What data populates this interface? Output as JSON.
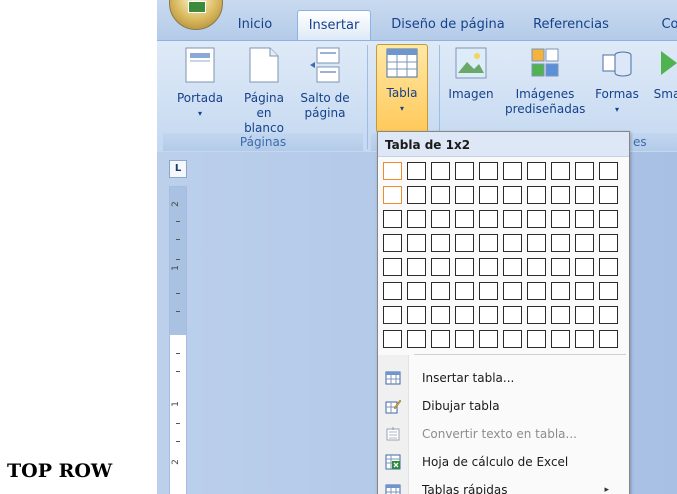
{
  "tabs": [
    {
      "label": "Inicio"
    },
    {
      "label": "Insertar"
    },
    {
      "label": "Diseño de página"
    },
    {
      "label": "Referencias"
    },
    {
      "label": "Co"
    }
  ],
  "ribbon": {
    "portada": {
      "line1": "Portada",
      "drop": "▾"
    },
    "pagina_blanco": {
      "line1": "Página",
      "line2": "en blanco"
    },
    "salto": {
      "line1": "Salto de",
      "line2": "página"
    },
    "tabla": {
      "line1": "Tabla",
      "drop": "▾"
    },
    "imagen": {
      "line1": "Imagen"
    },
    "imagenes_pred": {
      "line1": "Imágenes",
      "line2": "prediseñadas"
    },
    "formas": {
      "line1": "Formas",
      "drop": "▾"
    },
    "smart": {
      "line1": "Sma"
    },
    "group_paginas": "Páginas",
    "group_partial": "es"
  },
  "ruler": {
    "label": "L",
    "numbers": [
      "2",
      "1",
      "1",
      "2"
    ]
  },
  "dropdown": {
    "title": "Tabla de 1x2",
    "grid_cols": 10,
    "grid_rows": 8,
    "selected_cols": 1,
    "selected_rows": 2,
    "items": [
      {
        "label": "Insertar tabla...",
        "icon": "insert-table-icon",
        "disabled": false
      },
      {
        "label": "Dibujar tabla",
        "icon": "draw-table-icon",
        "disabled": false
      },
      {
        "label": "Convertir texto en tabla...",
        "icon": "convert-text-icon",
        "disabled": true
      },
      {
        "label": "Hoja de cálculo de Excel",
        "icon": "excel-sheet-icon",
        "disabled": false
      },
      {
        "label": "Tablas rápidas",
        "icon": "quick-tables-icon",
        "disabled": false,
        "submenu": "▸"
      }
    ]
  },
  "caption": "TOP ROW"
}
